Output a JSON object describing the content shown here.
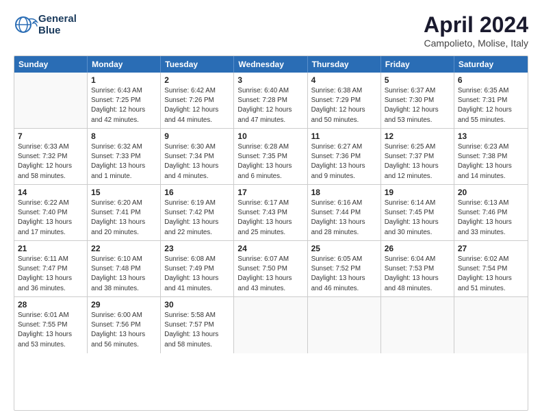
{
  "header": {
    "logo_line1": "General",
    "logo_line2": "Blue",
    "month": "April 2024",
    "location": "Campolieto, Molise, Italy"
  },
  "weekdays": [
    "Sunday",
    "Monday",
    "Tuesday",
    "Wednesday",
    "Thursday",
    "Friday",
    "Saturday"
  ],
  "rows": [
    [
      {
        "day": "",
        "info": ""
      },
      {
        "day": "1",
        "info": "Sunrise: 6:43 AM\nSunset: 7:25 PM\nDaylight: 12 hours\nand 42 minutes."
      },
      {
        "day": "2",
        "info": "Sunrise: 6:42 AM\nSunset: 7:26 PM\nDaylight: 12 hours\nand 44 minutes."
      },
      {
        "day": "3",
        "info": "Sunrise: 6:40 AM\nSunset: 7:28 PM\nDaylight: 12 hours\nand 47 minutes."
      },
      {
        "day": "4",
        "info": "Sunrise: 6:38 AM\nSunset: 7:29 PM\nDaylight: 12 hours\nand 50 minutes."
      },
      {
        "day": "5",
        "info": "Sunrise: 6:37 AM\nSunset: 7:30 PM\nDaylight: 12 hours\nand 53 minutes."
      },
      {
        "day": "6",
        "info": "Sunrise: 6:35 AM\nSunset: 7:31 PM\nDaylight: 12 hours\nand 55 minutes."
      }
    ],
    [
      {
        "day": "7",
        "info": "Sunrise: 6:33 AM\nSunset: 7:32 PM\nDaylight: 12 hours\nand 58 minutes."
      },
      {
        "day": "8",
        "info": "Sunrise: 6:32 AM\nSunset: 7:33 PM\nDaylight: 13 hours\nand 1 minute."
      },
      {
        "day": "9",
        "info": "Sunrise: 6:30 AM\nSunset: 7:34 PM\nDaylight: 13 hours\nand 4 minutes."
      },
      {
        "day": "10",
        "info": "Sunrise: 6:28 AM\nSunset: 7:35 PM\nDaylight: 13 hours\nand 6 minutes."
      },
      {
        "day": "11",
        "info": "Sunrise: 6:27 AM\nSunset: 7:36 PM\nDaylight: 13 hours\nand 9 minutes."
      },
      {
        "day": "12",
        "info": "Sunrise: 6:25 AM\nSunset: 7:37 PM\nDaylight: 13 hours\nand 12 minutes."
      },
      {
        "day": "13",
        "info": "Sunrise: 6:23 AM\nSunset: 7:38 PM\nDaylight: 13 hours\nand 14 minutes."
      }
    ],
    [
      {
        "day": "14",
        "info": "Sunrise: 6:22 AM\nSunset: 7:40 PM\nDaylight: 13 hours\nand 17 minutes."
      },
      {
        "day": "15",
        "info": "Sunrise: 6:20 AM\nSunset: 7:41 PM\nDaylight: 13 hours\nand 20 minutes."
      },
      {
        "day": "16",
        "info": "Sunrise: 6:19 AM\nSunset: 7:42 PM\nDaylight: 13 hours\nand 22 minutes."
      },
      {
        "day": "17",
        "info": "Sunrise: 6:17 AM\nSunset: 7:43 PM\nDaylight: 13 hours\nand 25 minutes."
      },
      {
        "day": "18",
        "info": "Sunrise: 6:16 AM\nSunset: 7:44 PM\nDaylight: 13 hours\nand 28 minutes."
      },
      {
        "day": "19",
        "info": "Sunrise: 6:14 AM\nSunset: 7:45 PM\nDaylight: 13 hours\nand 30 minutes."
      },
      {
        "day": "20",
        "info": "Sunrise: 6:13 AM\nSunset: 7:46 PM\nDaylight: 13 hours\nand 33 minutes."
      }
    ],
    [
      {
        "day": "21",
        "info": "Sunrise: 6:11 AM\nSunset: 7:47 PM\nDaylight: 13 hours\nand 36 minutes."
      },
      {
        "day": "22",
        "info": "Sunrise: 6:10 AM\nSunset: 7:48 PM\nDaylight: 13 hours\nand 38 minutes."
      },
      {
        "day": "23",
        "info": "Sunrise: 6:08 AM\nSunset: 7:49 PM\nDaylight: 13 hours\nand 41 minutes."
      },
      {
        "day": "24",
        "info": "Sunrise: 6:07 AM\nSunset: 7:50 PM\nDaylight: 13 hours\nand 43 minutes."
      },
      {
        "day": "25",
        "info": "Sunrise: 6:05 AM\nSunset: 7:52 PM\nDaylight: 13 hours\nand 46 minutes."
      },
      {
        "day": "26",
        "info": "Sunrise: 6:04 AM\nSunset: 7:53 PM\nDaylight: 13 hours\nand 48 minutes."
      },
      {
        "day": "27",
        "info": "Sunrise: 6:02 AM\nSunset: 7:54 PM\nDaylight: 13 hours\nand 51 minutes."
      }
    ],
    [
      {
        "day": "28",
        "info": "Sunrise: 6:01 AM\nSunset: 7:55 PM\nDaylight: 13 hours\nand 53 minutes."
      },
      {
        "day": "29",
        "info": "Sunrise: 6:00 AM\nSunset: 7:56 PM\nDaylight: 13 hours\nand 56 minutes."
      },
      {
        "day": "30",
        "info": "Sunrise: 5:58 AM\nSunset: 7:57 PM\nDaylight: 13 hours\nand 58 minutes."
      },
      {
        "day": "",
        "info": ""
      },
      {
        "day": "",
        "info": ""
      },
      {
        "day": "",
        "info": ""
      },
      {
        "day": "",
        "info": ""
      }
    ]
  ]
}
